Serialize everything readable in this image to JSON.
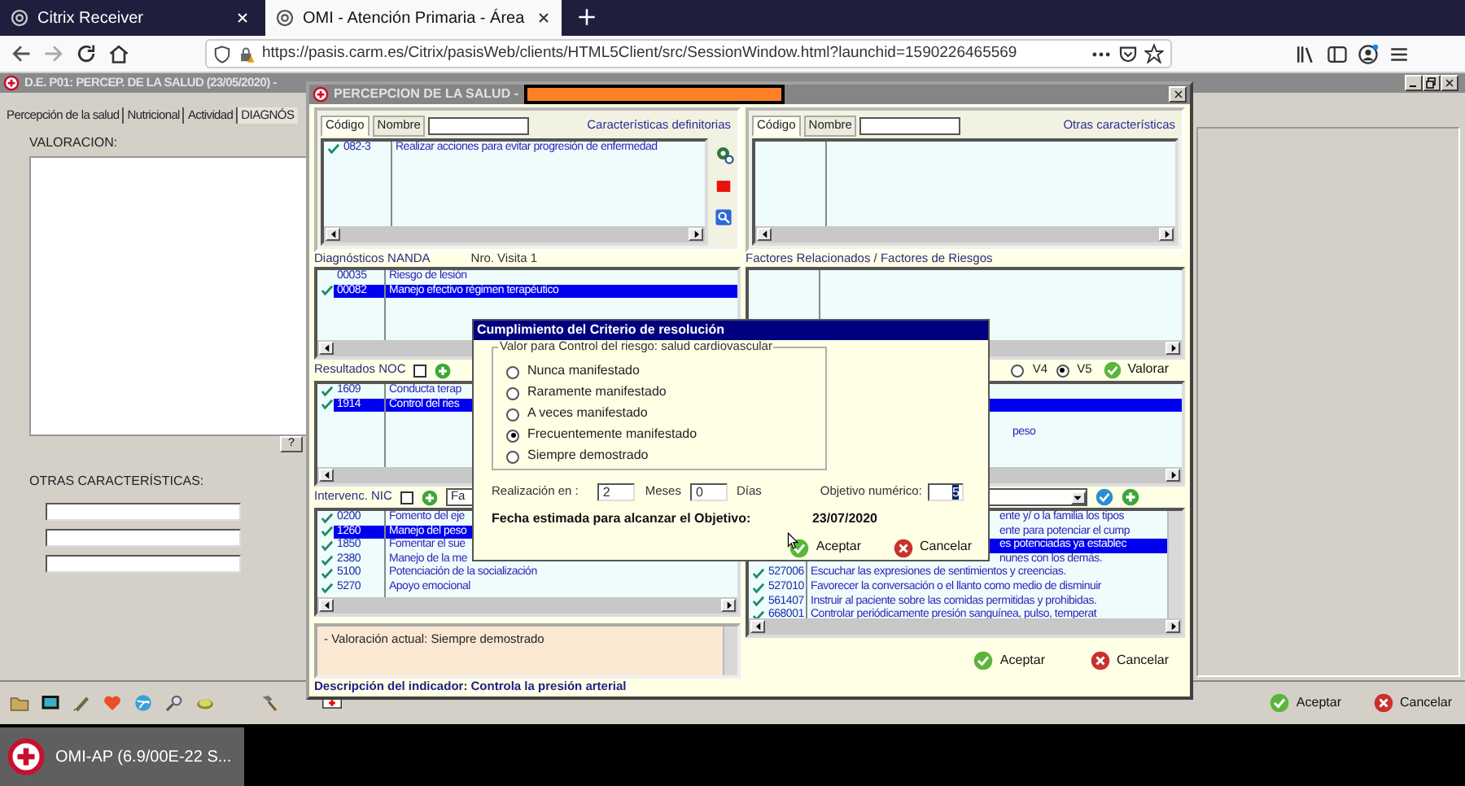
{
  "browser": {
    "tabs": [
      {
        "title": "Citrix Receiver",
        "selected": false
      },
      {
        "title": "OMI - Atención Primaria - Área",
        "selected": true
      }
    ],
    "url": "https://pasis.carm.es/Citrix/pasisWeb/clients/HTML5Client/src/SessionWindow.html?launchid=1590226465569"
  },
  "main_window": {
    "title": "D.E. P01: PERCEP. DE LA SALUD (23/05/2020) - ",
    "tabs": [
      {
        "label": "Percepción de la salud",
        "selected": false
      },
      {
        "label": "Nutricional",
        "selected": false
      },
      {
        "label": "Actividad",
        "selected": false
      },
      {
        "label": "DIAGNÓS",
        "selected": true
      }
    ],
    "valoracion_label": "VALORACION:",
    "help_button": "?",
    "otras_label": "OTRAS CARACTERÍSTICAS:",
    "buttons": [
      {
        "label": "Aceptar",
        "kind": "accept"
      },
      {
        "label": "Cancelar",
        "kind": "cancel"
      }
    ]
  },
  "dialog": {
    "title": "PERCEPCION DE LA SALUD - ",
    "characteristics": [
      {
        "tabs": [
          {
            "label": "Código",
            "selected": true
          },
          {
            "label": "Nombre",
            "selected": false
          }
        ],
        "link": "Características definitorias",
        "rows": [
          {
            "code": "082-3",
            "text": "Realizar acciones para evitar progresión de enfermedad",
            "checked": true,
            "selected": false
          }
        ]
      },
      {
        "tabs": [
          {
            "label": "Código",
            "selected": true
          },
          {
            "label": "Nombre",
            "selected": false
          }
        ],
        "link": "Otras características"
      }
    ],
    "nanda": {
      "label": "Diagnósticos NANDA",
      "visit": "Nro. Visita 1",
      "rows": [
        {
          "code": "00035",
          "text": "Riesgo de lesión",
          "checked": false,
          "selected": false
        },
        {
          "code": "00082",
          "text": "Manejo efectivo régimen terapéutico",
          "checked": true,
          "selected": true
        }
      ]
    },
    "factores": {
      "label": "Factores Relacionados / Factores de Riesgos"
    },
    "noc": {
      "label": "Resultados NOC",
      "checked": false,
      "versions": [
        {
          "label": "V4",
          "selected": false
        },
        {
          "label": "V5",
          "selected": true
        }
      ],
      "valorar": "Valorar",
      "rows": [
        {
          "code": "1609",
          "text": "Conducta terap",
          "checked": true,
          "selected": false
        },
        {
          "code": "1914",
          "text": "Control del ries",
          "checked": true,
          "selected": true
        }
      ],
      "side_rows": [
        {
          "selected": false
        },
        {
          "selected": true
        },
        {
          "selected": false
        },
        {
          "text": "peso",
          "selected": false
        }
      ]
    },
    "nic": {
      "label": "Intervenc. NIC",
      "checked": false,
      "filter": "Fa",
      "rows": [
        {
          "code": "0200",
          "text": "Fomento del eje",
          "checked": true,
          "selected": false
        },
        {
          "code": "1260",
          "text": "Manejo del peso",
          "checked": true,
          "selected": true
        },
        {
          "code": "1850",
          "text": "Fomentar el sue",
          "checked": true,
          "selected": false
        },
        {
          "code": "2380",
          "text": "Manejo de la me",
          "checked": true,
          "selected": false
        },
        {
          "code": "5100",
          "text": "Potenciación de la socialización",
          "checked": true,
          "selected": false
        },
        {
          "code": "5270",
          "text": "Apoyo emocional",
          "checked": true,
          "selected": false
        }
      ],
      "activities": [
        {
          "text": "ente y/ o la familia los tipos",
          "selected": false
        },
        {
          "text": "ente para potenciar el cump",
          "selected": false
        },
        {
          "text": "es potenciadas ya establec",
          "selected": true
        },
        {
          "text": "nunes con los demás.",
          "selected": false
        },
        {
          "code": "527006",
          "text": "Escuchar las expresiones de sentimientos y creencias.",
          "checked": true,
          "selected": false
        },
        {
          "code": "527010",
          "text": "Favorecer la conversación o el llanto como medio de disminuir",
          "checked": true,
          "selected": false
        },
        {
          "code": "561407",
          "text": "Instruir al paciente sobre las comidas permitidas y prohibidas.",
          "checked": true,
          "selected": false
        },
        {
          "code": "668001",
          "text": "Controlar periódicamente presión sanguínea, pulso, temperat",
          "checked": true,
          "selected": false
        }
      ]
    },
    "valoracion": "- Valoración actual: Siempre demostrado",
    "description": "Descripción del indicador: Controla la presión arterial",
    "buttons": [
      {
        "label": "Aceptar",
        "kind": "accept"
      },
      {
        "label": "Cancelar",
        "kind": "cancel"
      }
    ]
  },
  "modal": {
    "title": "Cumplimiento del Criterio de resolución",
    "group_label": "Valor para Control del riesgo: salud cardiovascular",
    "options": [
      {
        "label": "Nunca manifestado",
        "selected": false
      },
      {
        "label": "Raramente manifestado",
        "selected": false
      },
      {
        "label": "A veces manifestado",
        "selected": false
      },
      {
        "label": "Frecuentemente manifestado",
        "selected": true
      },
      {
        "label": "Siempre demostrado",
        "selected": false
      }
    ],
    "realizacion_label": "Realización en :",
    "months": "2",
    "months_label": "Meses",
    "days": "0",
    "days_label": "Días",
    "objective_label": "Objetivo numérico:",
    "objective": "5",
    "date_label": "Fecha estimada para alcanzar el Objetivo:",
    "date": "23/07/2020",
    "buttons": [
      {
        "label": "Aceptar",
        "kind": "accept"
      },
      {
        "label": "Cancelar",
        "kind": "cancel"
      }
    ]
  },
  "taskbar": {
    "app": "OMI-AP (6.9/00E-22 S..."
  }
}
